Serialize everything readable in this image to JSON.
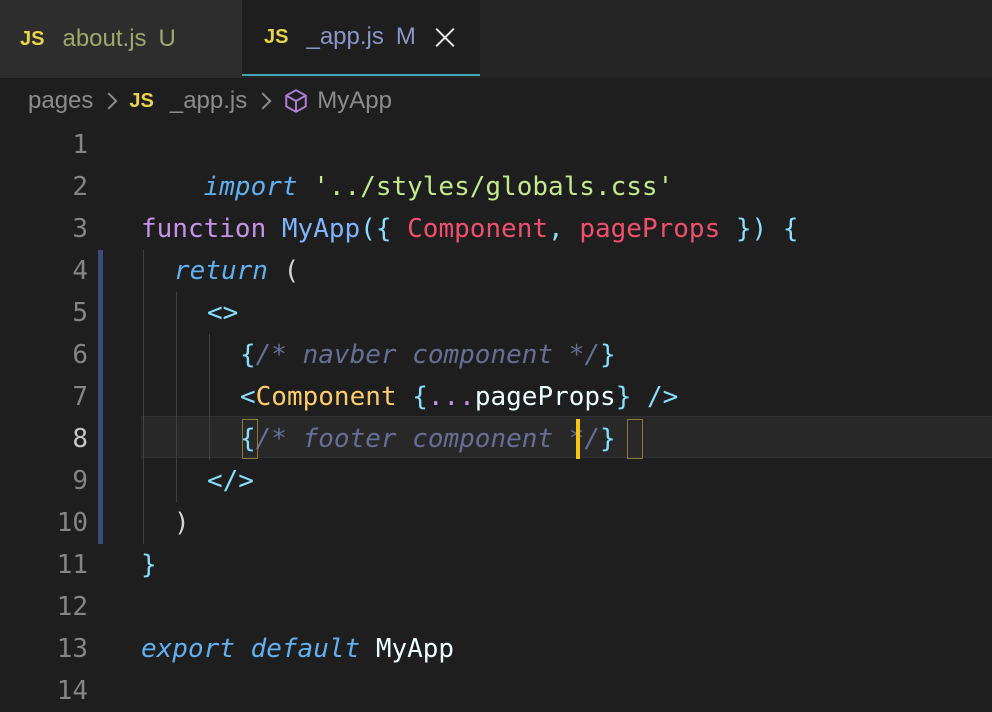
{
  "tabs": [
    {
      "badge": "JS",
      "name": "about.js",
      "status": "U"
    },
    {
      "badge": "JS",
      "name": "_app.js",
      "status": "M"
    }
  ],
  "breadcrumb": {
    "folder": "pages",
    "file_badge": "JS",
    "file": "_app.js",
    "symbol": "MyApp",
    "symbol_icon": "cube-icon"
  },
  "colors": {
    "accent_tab_border": "#3fa6b6",
    "js_badge": "#e8d44d",
    "cursor": "#f5c518"
  },
  "editor": {
    "line_numbers": [
      "1",
      "2",
      "3",
      "4",
      "5",
      "6",
      "7",
      "8",
      "9",
      "10",
      "11",
      "12",
      "13",
      "14"
    ],
    "lines": [
      {
        "t1": "import",
        "t2": " ",
        "t3": "'../styles/globals.css'"
      },
      {},
      {
        "t1": "function",
        "t2": " ",
        "t3": "MyApp",
        "t4": "({",
        "t5": " ",
        "t6": "Component",
        "t7": ",",
        "t8": " ",
        "t9": "pageProps",
        "t10": " ",
        "t11": "})",
        "t12": " ",
        "t13": "{"
      },
      {
        "t1": "return",
        "t2": " ",
        "t3": "("
      },
      {
        "t1": "<>"
      },
      {
        "t1": "{",
        "t2": "/* navber component */",
        "t3": "}"
      },
      {
        "t1": "<",
        "t2": "Component",
        "t3": " ",
        "t4": "{",
        "t5": "...",
        "t6": "pageProps",
        "t7": "}",
        "t8": " ",
        "t9": "/>"
      },
      {
        "t1": "{",
        "t2": "/* footer component",
        "t3": " */",
        "t4": "}"
      },
      {
        "t1": "</>"
      },
      {
        "t1": ")"
      },
      {
        "t1": "}"
      },
      {},
      {
        "t1": "export",
        "t2": " ",
        "t3": "default",
        "t4": " ",
        "t5": "MyApp"
      },
      {}
    ]
  }
}
